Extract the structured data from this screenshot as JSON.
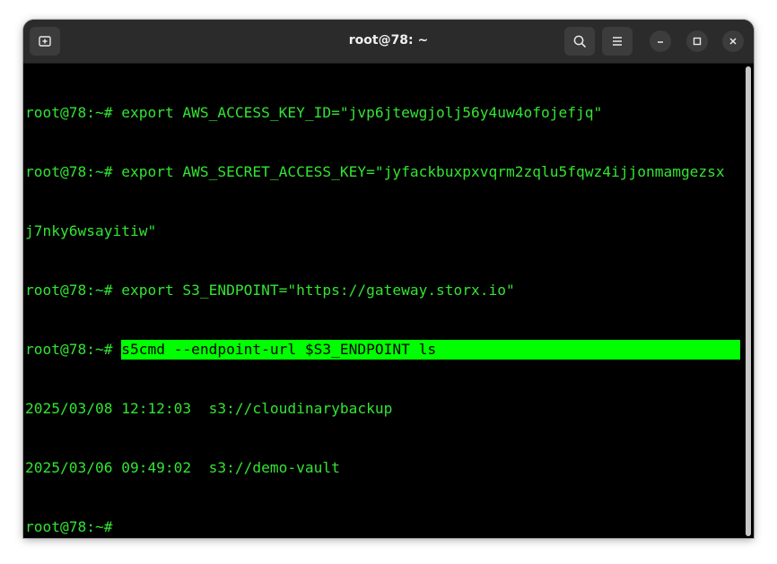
{
  "window": {
    "title": "root@78: ~"
  },
  "icons": {
    "new_tab": "new-tab-icon",
    "search": "search-icon",
    "menu": "hamburger-menu-icon",
    "minimize": "minimize-icon",
    "maximize": "maximize-icon",
    "close": "close-icon"
  },
  "colors": {
    "terminal_bg": "#000000",
    "terminal_text": "#33e433",
    "highlight_bg": "#00ff00",
    "titlebar_bg": "#2b2b2b"
  },
  "terminal": {
    "prompt": "root@78:~#",
    "lines": [
      {
        "prompt": "root@78:~#",
        "text": " export AWS_ACCESS_KEY_ID=\"jvp6jtewgjolj56y4uw4ofojefjq\""
      },
      {
        "prompt": "root@78:~#",
        "text": " export AWS_SECRET_ACCESS_KEY=\"jyfackbuxpxvqrm2zqlu5fqwz4ijjonmamgezsx"
      },
      {
        "prompt": "",
        "text": "j7nky6wsayitiw\""
      },
      {
        "prompt": "root@78:~#",
        "text": " export S3_ENDPOINT=\"https://gateway.storx.io\""
      },
      {
        "prompt": "root@78:~#",
        "text": "s5cmd --endpoint-url $S3_ENDPOINT ls"
      },
      {
        "prompt": "",
        "text": "2025/03/08 12:12:03  s3://cloudinarybackup"
      },
      {
        "prompt": "",
        "text": "2025/03/06 09:49:02  s3://demo-vault"
      },
      {
        "prompt": "root@78:~#",
        "text": ""
      }
    ]
  }
}
